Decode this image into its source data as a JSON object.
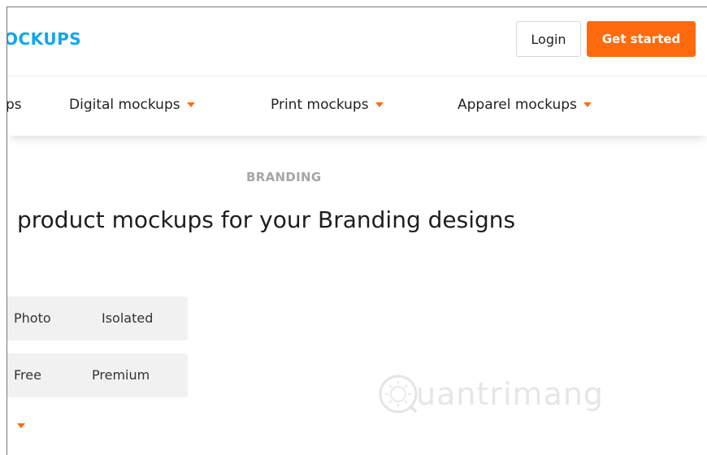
{
  "header": {
    "logo_text": "OCKUPS",
    "login_label": "Login",
    "get_started_label": "Get started"
  },
  "nav": {
    "items": [
      {
        "label": "ps",
        "has_caret": false
      },
      {
        "label": "Digital mockups",
        "has_caret": true
      },
      {
        "label": "Print mockups",
        "has_caret": true
      },
      {
        "label": "Apparel mockups",
        "has_caret": true
      }
    ]
  },
  "hero": {
    "eyebrow": "BRANDING",
    "headline": "product mockups for your Branding designs"
  },
  "filters": {
    "type_options": [
      "Photo",
      "Isolated"
    ],
    "price_options": [
      "Free",
      "Premium"
    ]
  },
  "watermark": {
    "text": "uantrimang"
  },
  "colors": {
    "accent": "#ff6a0e",
    "brand": "#11a6ee"
  }
}
